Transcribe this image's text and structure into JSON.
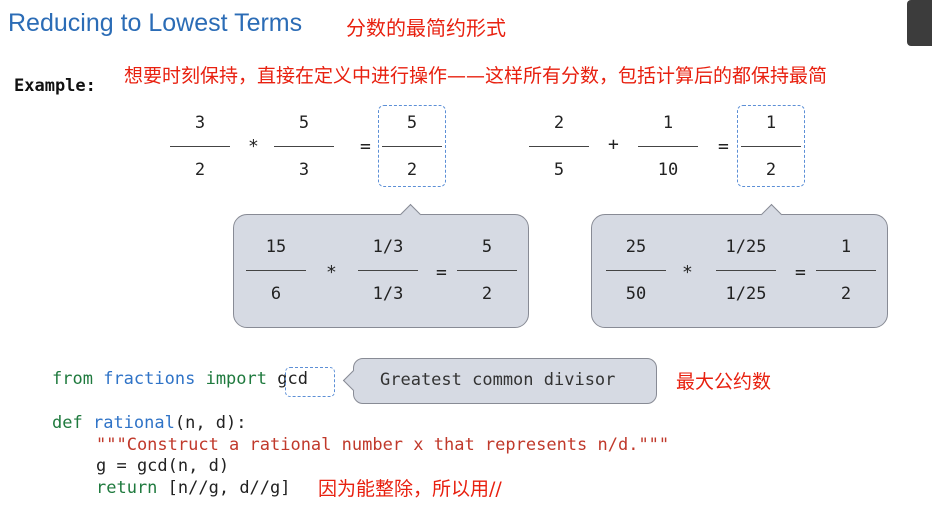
{
  "header": {
    "title": "Reducing to Lowest Terms",
    "title_note_cn": "分数的最简约形式"
  },
  "example": {
    "label": "Example:",
    "note_cn": "想要时刻保持，直接在定义中进行操作——这样所有分数，包括计算后的都保持最简"
  },
  "equation1": {
    "a": {
      "num": "3",
      "den": "2"
    },
    "op": "*",
    "b": {
      "num": "5",
      "den": "3"
    },
    "eq": "=",
    "result": {
      "num": "5",
      "den": "2"
    },
    "detail": {
      "a": {
        "num": "15",
        "den": "6"
      },
      "op": "*",
      "b": {
        "num": "1/3",
        "den": "1/3"
      },
      "eq": "=",
      "result": {
        "num": "5",
        "den": "2"
      }
    }
  },
  "equation2": {
    "a": {
      "num": "2",
      "den": "5"
    },
    "op": "+",
    "b": {
      "num": "1",
      "den": "10"
    },
    "eq": "=",
    "result": {
      "num": "1",
      "den": "2"
    },
    "detail": {
      "a": {
        "num": "25",
        "den": "50"
      },
      "op": "*",
      "b": {
        "num": "1/25",
        "den": "1/25"
      },
      "eq": "=",
      "result": {
        "num": "1",
        "den": "2"
      }
    }
  },
  "code": {
    "line1": {
      "from": "from",
      "module": "fractions",
      "import": "import",
      "name": "gcd"
    },
    "callout": "Greatest common divisor",
    "callout_note_cn": "最大公约数",
    "line2": {
      "def": "def",
      "fname": "rational",
      "args": "(n, d):"
    },
    "line3": "\"\"\"Construct a rational number x that represents n/d.\"\"\"",
    "line4": "g = gcd(n, d)",
    "line5": {
      "return": "return",
      "expr": "[n//g, d//g]"
    },
    "line5_note_cn": "因为能整除，所以用//"
  },
  "colors": {
    "title": "#2b6cb6",
    "annotation": "#e8200f",
    "keyword": "#1f7a3e",
    "name": "#2f73c7",
    "string": "#c0392b",
    "bubble": "#d6dae3"
  }
}
